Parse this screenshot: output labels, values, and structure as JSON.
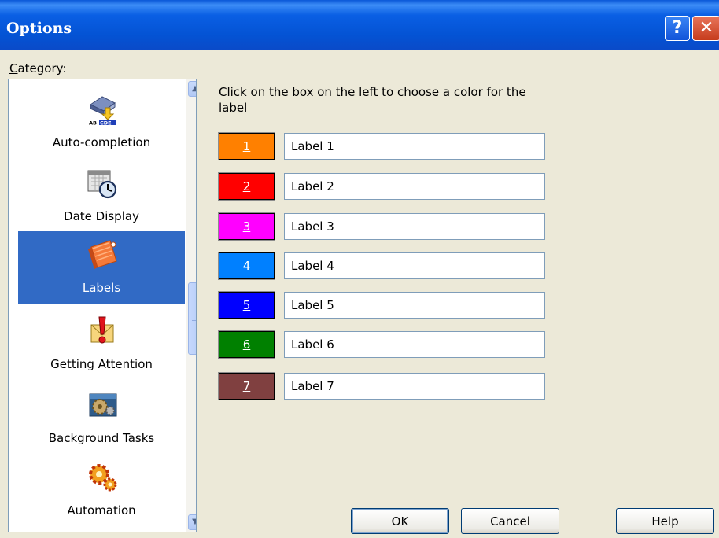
{
  "window": {
    "title": "Options",
    "help_glyph": "?",
    "close_glyph": "✕"
  },
  "category": {
    "label_prefix": "",
    "label_accel": "C",
    "label_rest": "ategory:",
    "items": [
      {
        "label": "Auto-completion",
        "icon": "auto-completion-icon"
      },
      {
        "label": "Date Display",
        "icon": "date-display-icon"
      },
      {
        "label": "Labels",
        "icon": "labels-icon",
        "selected": true
      },
      {
        "label": "Getting Attention",
        "icon": "getting-attention-icon"
      },
      {
        "label": "Background Tasks",
        "icon": "background-tasks-icon"
      },
      {
        "label": "Automation",
        "icon": "automation-icon"
      }
    ],
    "scroll_up": "▲",
    "scroll_down": "▼"
  },
  "instructions": "Click on the box on the left to choose a color for the label",
  "labels": [
    {
      "number": "1",
      "color": "#ff8000",
      "value": "Label 1"
    },
    {
      "number": "2",
      "color": "#ff0000",
      "value": "Label 2"
    },
    {
      "number": "3",
      "color": "#ff00ff",
      "value": "Label 3"
    },
    {
      "number": "4",
      "color": "#0080ff",
      "value": "Label 4"
    },
    {
      "number": "5",
      "color": "#0000ff",
      "value": "Label 5"
    },
    {
      "number": "6",
      "color": "#008000",
      "value": "Label 6"
    },
    {
      "number": "7",
      "color": "#804040",
      "value": "Label 7"
    }
  ],
  "buttons": {
    "ok": "OK",
    "cancel": "Cancel",
    "help": "Help"
  }
}
